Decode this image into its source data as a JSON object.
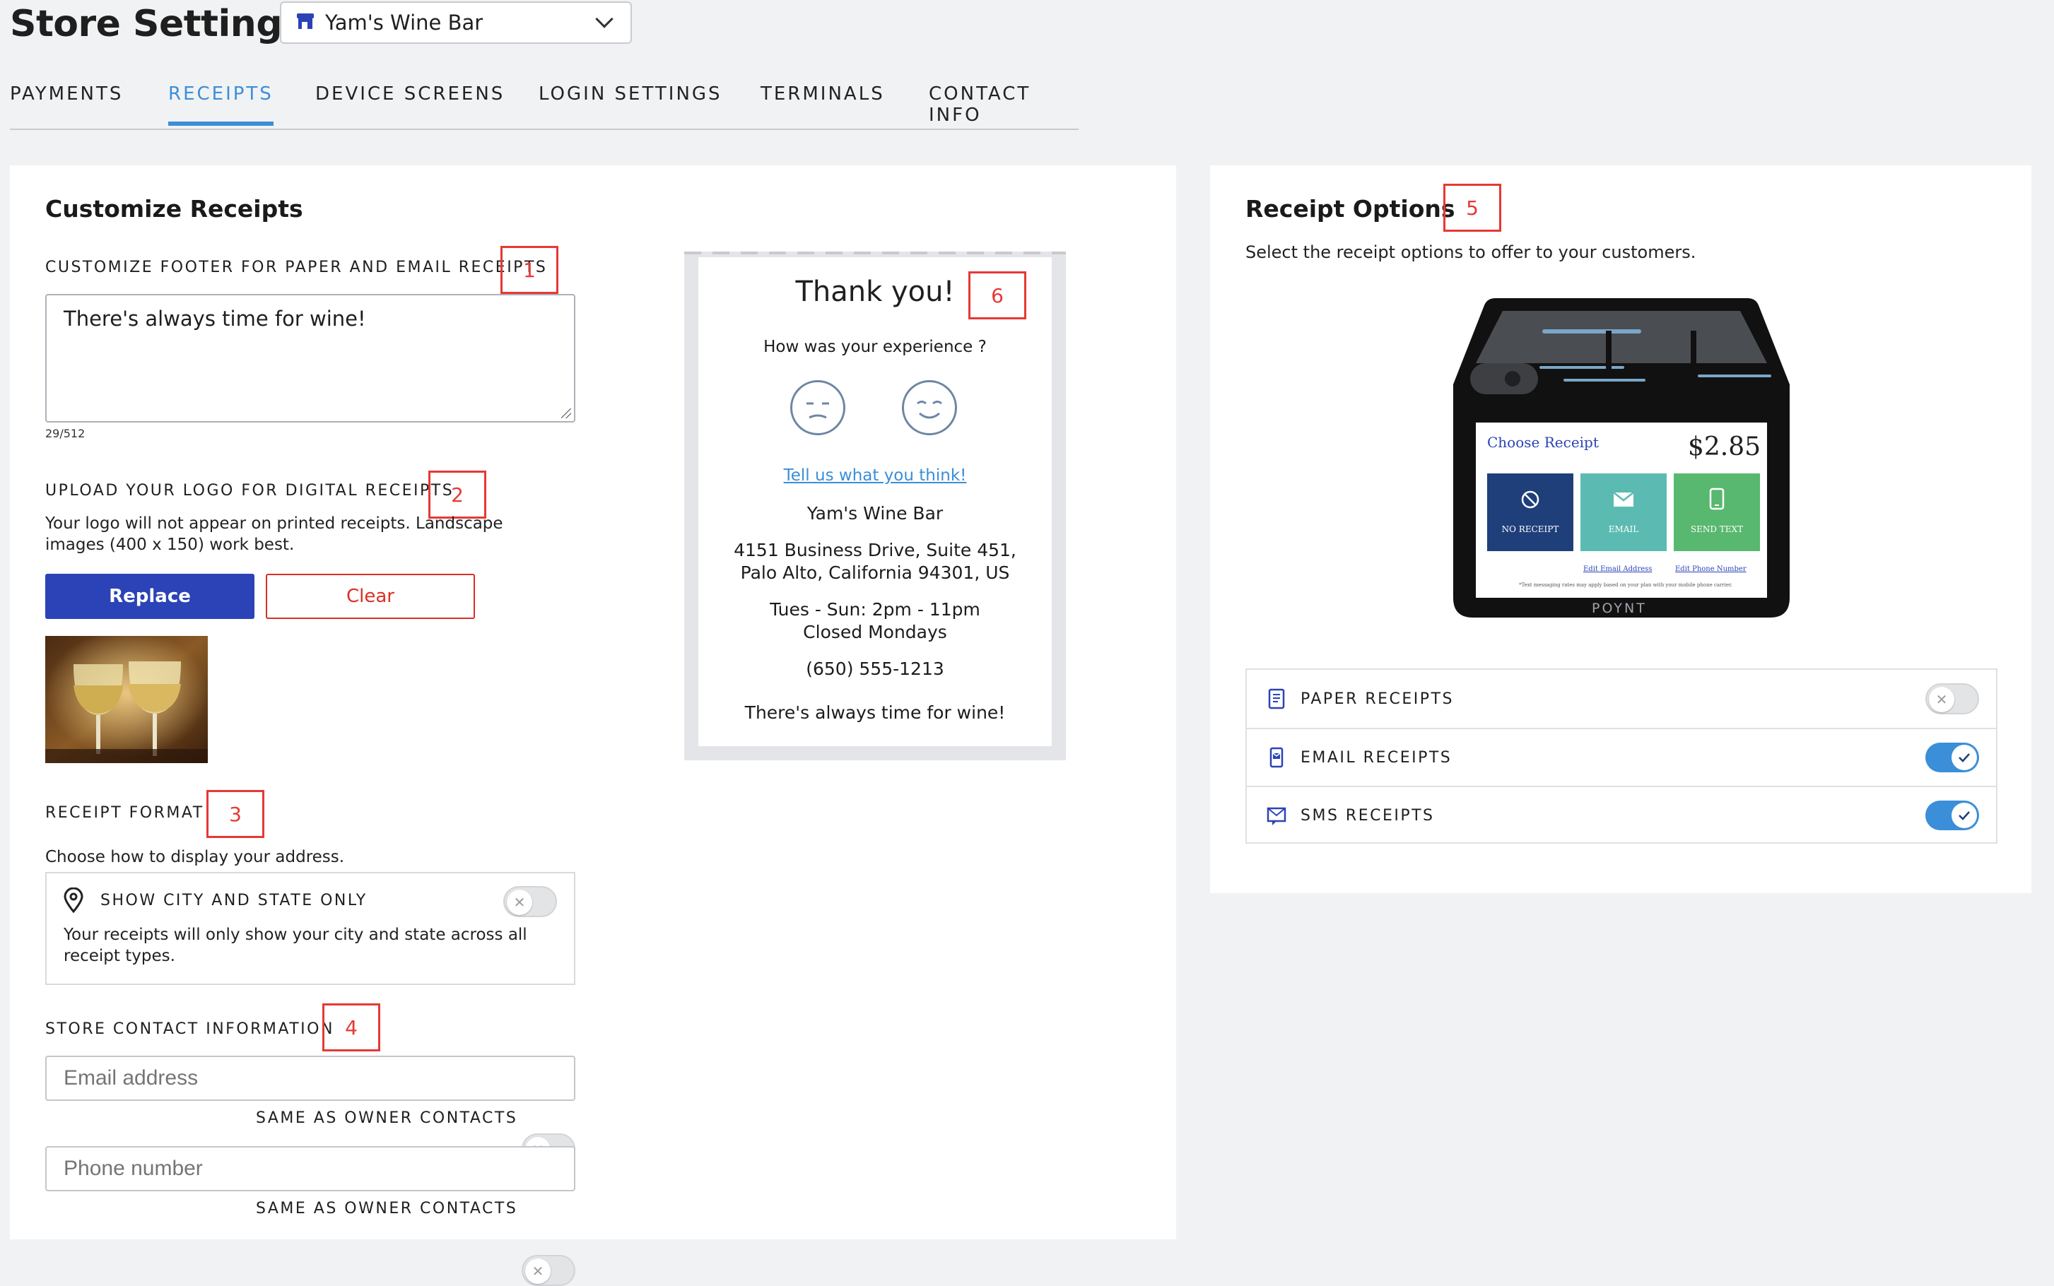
{
  "header": {
    "title": "Store Settings",
    "store_name": "Yam's Wine Bar"
  },
  "tabs": [
    {
      "label": "PAYMENTS",
      "active": false
    },
    {
      "label": "RECEIPTS",
      "active": true
    },
    {
      "label": "DEVICE SCREENS",
      "active": false
    },
    {
      "label": "LOGIN SETTINGS",
      "active": false
    },
    {
      "label": "TERMINALS",
      "active": false
    },
    {
      "label": "CONTACT INFO",
      "active": false
    }
  ],
  "customize": {
    "title": "Customize Receipts",
    "footer_label": "CUSTOMIZE FOOTER FOR PAPER AND EMAIL RECEIPTS",
    "footer_value": "There's always time for wine!",
    "char_count": "29/512",
    "logo_label": "UPLOAD YOUR LOGO FOR DIGITAL RECEIPTS",
    "logo_help": "Your logo will not appear on printed receipts. Landscape images (400 x 150) work best.",
    "replace_label": "Replace",
    "clear_label": "Clear",
    "format_label": "RECEIPT FORMAT",
    "format_help": "Choose how to display your address.",
    "city_state_label": "SHOW CITY AND STATE ONLY",
    "city_state_help": "Your receipts will only show your city and state across all receipt types.",
    "city_state_on": false,
    "contact_label": "STORE CONTACT INFORMATION",
    "email_placeholder": "Email address",
    "phone_placeholder": "Phone number",
    "same_as_owner": "SAME AS OWNER CONTACTS"
  },
  "markers": [
    "1",
    "2",
    "3",
    "4",
    "5",
    "6"
  ],
  "preview": {
    "thank_you": "Thank you!",
    "question": "How was your experience ?",
    "feedback_link": "Tell us what you think!",
    "store_name": "Yam's Wine Bar",
    "address_line1": "4151 Business Drive, Suite 451,",
    "address_line2": "Palo Alto, California 94301, US",
    "hours_line1": "Tues - Sun: 2pm - 11pm",
    "hours_line2": "Closed Mondays",
    "phone": "(650) 555-1213",
    "footer": "There's always time for wine!"
  },
  "options": {
    "title": "Receipt Options",
    "subtitle": "Select the receipt options to offer to your customers.",
    "terminal": {
      "choose_receipt": "Choose Receipt",
      "amount": "$2.85",
      "no_receipt": "NO RECEIPT",
      "email": "EMAIL",
      "send_text": "SEND TEXT",
      "edit_email": "Edit Email Address",
      "edit_phone": "Edit Phone Number",
      "disclaimer": "*Text messaging rates may apply based on your plan with your mobile phone carrier.",
      "brand": "POYNT"
    },
    "items": [
      {
        "label": "PAPER RECEIPTS",
        "icon": "paper-receipt-icon",
        "enabled": false
      },
      {
        "label": "EMAIL RECEIPTS",
        "icon": "email-receipt-icon",
        "enabled": true
      },
      {
        "label": "SMS RECEIPTS",
        "icon": "sms-receipt-icon",
        "enabled": true
      }
    ]
  },
  "colors": {
    "accent": "#3b8ed8",
    "primary_button": "#2b43b7",
    "danger": "#d93025",
    "marker": "#e53935",
    "tile_no_receipt": "#1f3f7a",
    "tile_email": "#5bbbb2",
    "tile_send_text": "#58b86f"
  }
}
